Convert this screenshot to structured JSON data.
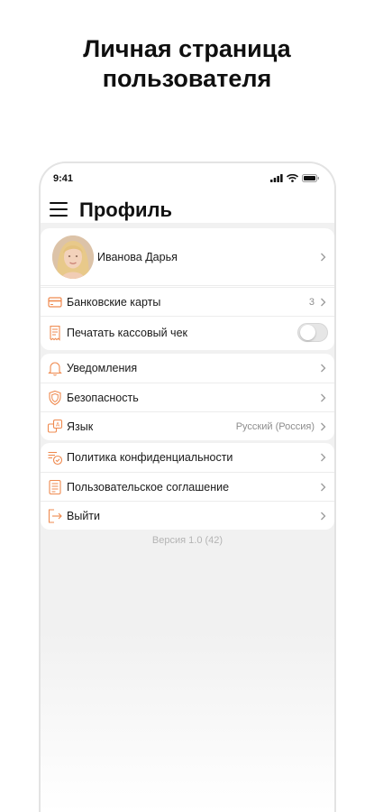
{
  "headline": {
    "line1": "Личная страница",
    "line2": "пользователя"
  },
  "status_bar": {
    "time": "9:41",
    "icons": [
      "signal-icon",
      "wifi-icon",
      "battery-icon"
    ]
  },
  "header": {
    "title": "Профиль",
    "menu_icon": "menu-icon"
  },
  "profile": {
    "name": "Иванова Дарья"
  },
  "groups": {
    "payments": {
      "bank_cards": {
        "label": "Банковские карты",
        "value": "3",
        "icon": "card-icon"
      },
      "print_receipt": {
        "label": "Печатать кассовый чек",
        "toggle_on": false,
        "icon": "receipt-icon"
      }
    },
    "settings": {
      "notifications": {
        "label": "Уведомления",
        "icon": "bell-icon"
      },
      "security": {
        "label": "Безопасность",
        "icon": "shield-icon"
      },
      "language": {
        "label": "Язык",
        "value": "Русский (Россия)",
        "icon": "language-icon"
      }
    },
    "legal": {
      "privacy": {
        "label": "Политика конфиденциальности",
        "icon": "privacy-icon"
      },
      "agreement": {
        "label": "Пользовательское соглашение",
        "icon": "document-icon"
      },
      "logout": {
        "label": "Выйти",
        "icon": "logout-icon"
      }
    }
  },
  "version": "Версия 1.0 (42)",
  "colors": {
    "accent": "#ef8a4f",
    "background": "#f1f1f1",
    "text": "#1a1a1a",
    "secondary_text": "#8e8e8e"
  }
}
